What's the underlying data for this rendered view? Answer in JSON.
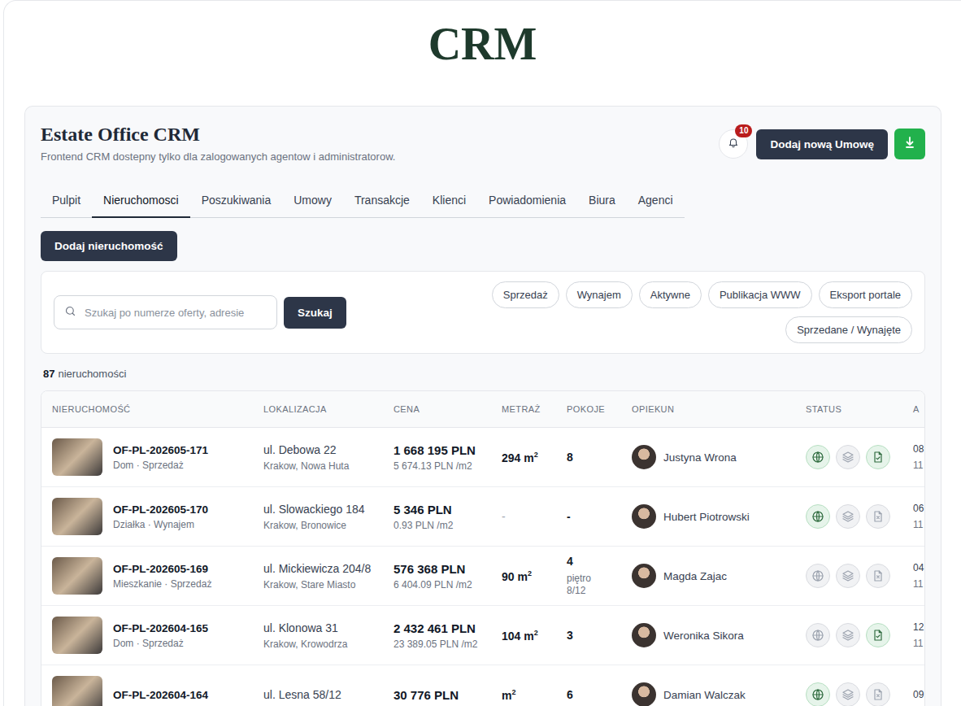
{
  "app": {
    "logo": "CRM",
    "title": "Estate Office CRM",
    "subtitle": "Frontend CRM dostepny tylko dla zalogowanych agentow i administratorow.",
    "notifications_badge": "10",
    "primary_button": "Dodaj nową Umowę"
  },
  "tabs": [
    {
      "label": "Pulpit",
      "selected": false
    },
    {
      "label": "Nieruchomosci",
      "selected": true
    },
    {
      "label": "Poszukiwania",
      "selected": false
    },
    {
      "label": "Umowy",
      "selected": false
    },
    {
      "label": "Transakcje",
      "selected": false
    },
    {
      "label": "Klienci",
      "selected": false
    },
    {
      "label": "Powiadomienia",
      "selected": false
    },
    {
      "label": "Biura",
      "selected": false
    },
    {
      "label": "Agenci",
      "selected": false
    }
  ],
  "add_button": "Dodaj nieruchomość",
  "search": {
    "placeholder": "Szukaj po numerze oferty, adresie",
    "button": "Szukaj"
  },
  "filters": [
    {
      "label": "Sprzedaż",
      "selected": false
    },
    {
      "label": "Wynajem",
      "selected": false
    },
    {
      "label": "Aktywne",
      "selected": false
    },
    {
      "label": "Publikacja WWW",
      "selected": false
    },
    {
      "label": "Eksport portale",
      "selected": false
    },
    {
      "label": "Sprzedane / Wynajęte",
      "selected": false
    }
  ],
  "count": {
    "value": "87",
    "label": "nieruchomości"
  },
  "table": {
    "columns": [
      "NIERUCHOMOŚĆ",
      "LOKALIZACJA",
      "CENA",
      "METRAŻ",
      "POKOJE",
      "OPIEKUN",
      "STATUS",
      "A"
    ],
    "rows": [
      {
        "number": "OF-PL-202605-171",
        "type": "Dom · Sprzedaż",
        "street": "ul. Debowa 22",
        "city": "Krakow, Nowa Huta",
        "price": "1 668 195 PLN",
        "price_m2": "5 674.13 PLN /m2",
        "area": "294",
        "area_unit": " m",
        "area_sup": "2",
        "rooms": "8",
        "agent": "Justyna Wrona",
        "www": true,
        "export": false,
        "contract": true,
        "date1": "08",
        "date2": "11"
      },
      {
        "number": "OF-PL-202605-170",
        "type": "Działka · Wynajem",
        "street": "ul. Slowackiego 184",
        "city": "Krakow, Bronowice",
        "price": "5 346 PLN",
        "price_m2": "0.93 PLN /m2",
        "area": "-",
        "rooms": "-",
        "agent": "Hubert Piotrowski",
        "www": true,
        "export": false,
        "contract": false,
        "date1": "06",
        "date2": "11"
      },
      {
        "number": "OF-PL-202605-169",
        "type": "Mieszkanie · Sprzedaż",
        "street": "ul. Mickiewicza 204/8",
        "city": "Krakow, Stare Miasto",
        "price": "576 368 PLN",
        "price_m2": "6 404.09 PLN /m2",
        "area": "90",
        "area_unit": " m",
        "area_sup": "2",
        "rooms": "4",
        "floor_label": "piętro",
        "floor": "8/12",
        "agent": "Magda Zajac",
        "www": false,
        "export": false,
        "contract": false,
        "date1": "04",
        "date2": "11"
      },
      {
        "number": "OF-PL-202604-165",
        "type": "Dom · Sprzedaż",
        "street": "ul. Klonowa 31",
        "city": "Krakow, Krowodrza",
        "price": "2 432 461 PLN",
        "price_m2": "23 389.05 PLN /m2",
        "area": "104",
        "area_unit": " m",
        "area_sup": "2",
        "rooms": "3",
        "agent": "Weronika Sikora",
        "www": false,
        "export": false,
        "contract": true,
        "date1": "12",
        "date2": "11"
      },
      {
        "number": "OF-PL-202604-164",
        "street": "ul. Lesna 58/12",
        "price": "30 776 PLN",
        "area": "",
        "area_unit": " m",
        "area_sup": "2",
        "rooms": "6",
        "agent": "Damian Walczak",
        "www": true,
        "export": false,
        "contract": false,
        "date1": "09"
      }
    ]
  }
}
